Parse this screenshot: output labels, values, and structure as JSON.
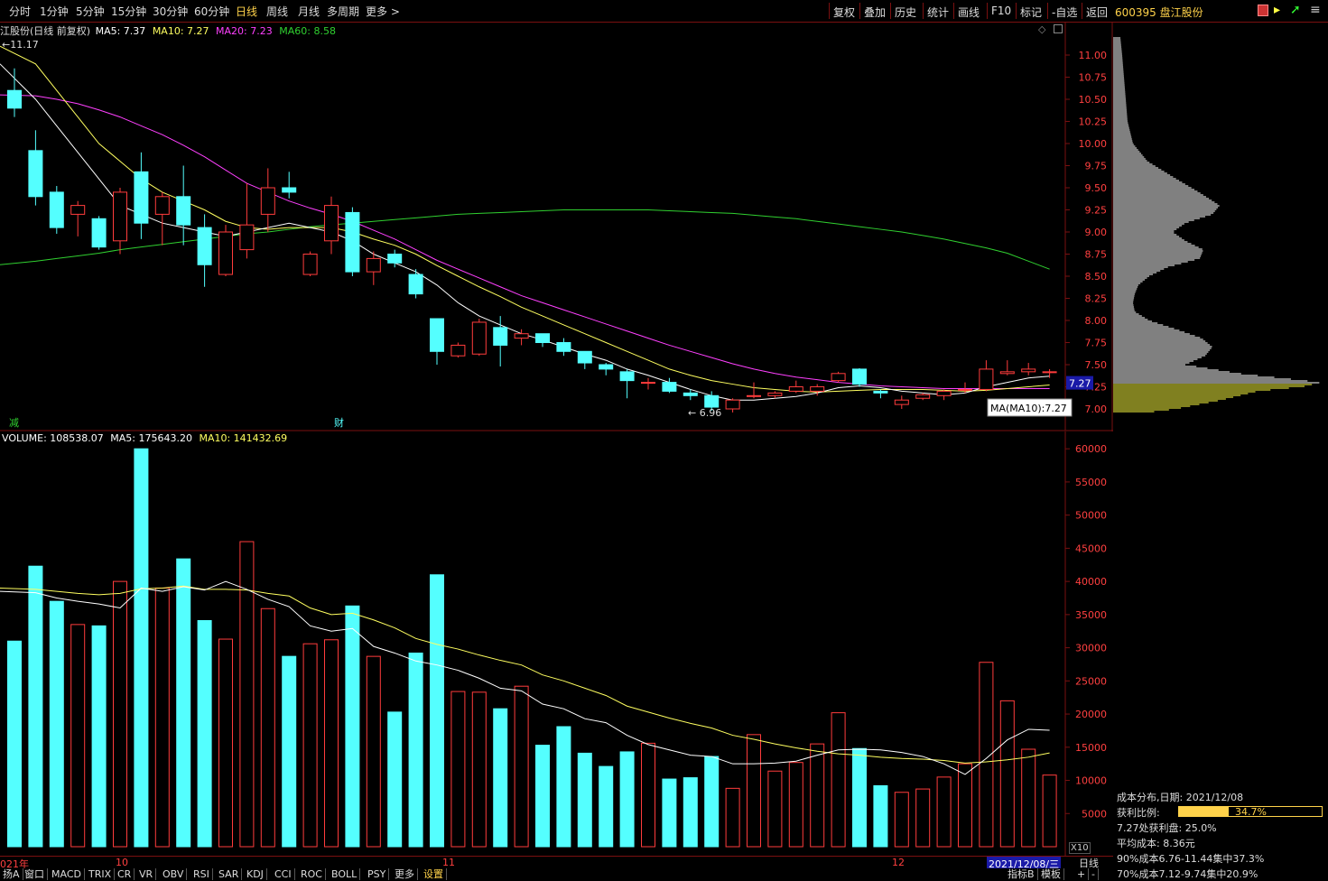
{
  "topbar": {
    "tabs": [
      "分时",
      "1分钟",
      "5分钟",
      "15分钟",
      "30分钟",
      "60分钟",
      "日线",
      "周线",
      "月线",
      "多周期",
      "更多 >"
    ],
    "active_tab": "日线",
    "right_buttons": [
      "复权",
      "叠加",
      "历史",
      "统计",
      "画线",
      "F10",
      "标记",
      "-自选",
      "返回"
    ]
  },
  "stock": {
    "code_name": "600395 盘江股份"
  },
  "price_header": {
    "name": "江股份(日线 前复权)",
    "ma5": "MA5: 7.37",
    "ma10": "MA10: 7.27",
    "ma20": "MA20: 7.23",
    "ma60": "MA60: 8.58"
  },
  "price_chart": {
    "high_label": "11.17",
    "low_label": "6.96",
    "current_price_tag": "7.27",
    "ma_tooltip": "MA(MA10):7.27",
    "y_ticks": [
      "11.00",
      "10.75",
      "10.50",
      "10.25",
      "10.00",
      "9.75",
      "9.50",
      "9.25",
      "9.00",
      "8.75",
      "8.50",
      "8.25",
      "8.00",
      "7.75",
      "7.50",
      "7.25",
      "7.00"
    ],
    "markers": [
      "减",
      "财"
    ]
  },
  "volume_header": {
    "volume": "VOLUME: 108538.07",
    "ma5": "MA5: 175643.20",
    "ma10": "MA10: 141432.69"
  },
  "volume_chart": {
    "y_ticks": [
      "60000",
      "55000",
      "50000",
      "45000",
      "40000",
      "35000",
      "30000",
      "25000",
      "20000",
      "15000",
      "10000",
      "5000"
    ],
    "unit": "X10"
  },
  "x_axis": {
    "labels": [
      "021年",
      "10",
      "11",
      "12"
    ],
    "date_box": "2021/12/08/三",
    "period": "日线"
  },
  "bottom_tabs": [
    "扬A",
    "窗口",
    "MACD",
    "TRIX",
    "CR",
    "VR",
    "OBV",
    "RSI",
    "SAR",
    "KDJ",
    "CCI",
    "ROC",
    "BOLL",
    "PSY",
    "更多",
    "设置"
  ],
  "bottom_right": [
    "+",
    "-",
    "指标B",
    "模板"
  ],
  "cost_panel": {
    "title": "成本分布,日期: 2021/12/08",
    "profit_ratio_label": "获利比例:",
    "profit_ratio_value": "34.7%",
    "profit_ratio": 0.347,
    "line3": "7.27处获利盘: 25.0%",
    "line4": "平均成本: 8.36元",
    "line5": "90%成本6.76-11.44集中37.3%",
    "line6": "70%成本7.12-9.74集中20.9%"
  },
  "colors": {
    "up": "#ff3c3c",
    "down": "#54ffff",
    "ma5": "#ffffff",
    "ma10": "#ffff60",
    "ma20": "#ff40ff",
    "ma60": "#30d030",
    "grid": "#7a1010",
    "accent_yellow": "#ffd24a"
  },
  "chart_data": {
    "type": "candlestick",
    "candles": [
      {
        "o": 10.6,
        "h": 10.85,
        "l": 10.3,
        "c": 10.4
      },
      {
        "o": 9.92,
        "h": 10.15,
        "l": 9.3,
        "c": 9.4
      },
      {
        "o": 9.45,
        "h": 9.52,
        "l": 8.98,
        "c": 9.05
      },
      {
        "o": 9.2,
        "h": 9.35,
        "l": 8.95,
        "c": 9.3
      },
      {
        "o": 9.15,
        "h": 9.18,
        "l": 8.8,
        "c": 8.83
      },
      {
        "o": 8.9,
        "h": 9.5,
        "l": 8.75,
        "c": 9.45
      },
      {
        "o": 9.68,
        "h": 9.9,
        "l": 8.92,
        "c": 9.1
      },
      {
        "o": 9.2,
        "h": 9.45,
        "l": 8.85,
        "c": 9.4
      },
      {
        "o": 9.4,
        "h": 9.75,
        "l": 8.85,
        "c": 9.08
      },
      {
        "o": 9.05,
        "h": 9.2,
        "l": 8.38,
        "c": 8.63
      },
      {
        "o": 8.52,
        "h": 9.08,
        "l": 8.5,
        "c": 9.0
      },
      {
        "o": 8.8,
        "h": 9.55,
        "l": 8.7,
        "c": 9.08
      },
      {
        "o": 9.2,
        "h": 9.72,
        "l": 9.0,
        "c": 9.5
      },
      {
        "o": 9.5,
        "h": 9.68,
        "l": 9.38,
        "c": 9.45
      },
      {
        "o": 8.52,
        "h": 8.78,
        "l": 8.5,
        "c": 8.75
      },
      {
        "o": 8.9,
        "h": 9.4,
        "l": 8.75,
        "c": 9.3
      },
      {
        "o": 9.22,
        "h": 9.28,
        "l": 8.5,
        "c": 8.55
      },
      {
        "o": 8.55,
        "h": 8.78,
        "l": 8.4,
        "c": 8.7
      },
      {
        "o": 8.75,
        "h": 8.8,
        "l": 8.6,
        "c": 8.65
      },
      {
        "o": 8.52,
        "h": 8.58,
        "l": 8.25,
        "c": 8.3
      },
      {
        "o": 8.02,
        "h": 8.02,
        "l": 7.5,
        "c": 7.65
      },
      {
        "o": 7.6,
        "h": 7.75,
        "l": 7.58,
        "c": 7.72
      },
      {
        "o": 7.62,
        "h": 8.02,
        "l": 7.6,
        "c": 7.98
      },
      {
        "o": 7.92,
        "h": 8.05,
        "l": 7.48,
        "c": 7.72
      },
      {
        "o": 7.8,
        "h": 7.9,
        "l": 7.72,
        "c": 7.85
      },
      {
        "o": 7.85,
        "h": 7.85,
        "l": 7.7,
        "c": 7.75
      },
      {
        "o": 7.75,
        "h": 7.8,
        "l": 7.6,
        "c": 7.65
      },
      {
        "o": 7.65,
        "h": 7.65,
        "l": 7.45,
        "c": 7.52
      },
      {
        "o": 7.5,
        "h": 7.52,
        "l": 7.38,
        "c": 7.45
      },
      {
        "o": 7.42,
        "h": 7.45,
        "l": 7.12,
        "c": 7.32
      },
      {
        "o": 7.3,
        "h": 7.35,
        "l": 7.22,
        "c": 7.3
      },
      {
        "o": 7.3,
        "h": 7.35,
        "l": 7.18,
        "c": 7.2
      },
      {
        "o": 7.18,
        "h": 7.22,
        "l": 7.1,
        "c": 7.15
      },
      {
        "o": 7.15,
        "h": 7.2,
        "l": 6.98,
        "c": 7.02
      },
      {
        "o": 7.0,
        "h": 7.12,
        "l": 6.96,
        "c": 7.1
      },
      {
        "o": 7.15,
        "h": 7.3,
        "l": 7.12,
        "c": 7.15
      },
      {
        "o": 7.15,
        "h": 7.2,
        "l": 7.12,
        "c": 7.18
      },
      {
        "o": 7.2,
        "h": 7.32,
        "l": 7.18,
        "c": 7.25
      },
      {
        "o": 7.2,
        "h": 7.28,
        "l": 7.15,
        "c": 7.25
      },
      {
        "o": 7.32,
        "h": 7.42,
        "l": 7.3,
        "c": 7.4
      },
      {
        "o": 7.45,
        "h": 7.46,
        "l": 7.25,
        "c": 7.28
      },
      {
        "o": 7.2,
        "h": 7.22,
        "l": 7.12,
        "c": 7.18
      },
      {
        "o": 7.05,
        "h": 7.15,
        "l": 7.0,
        "c": 7.1
      },
      {
        "o": 7.12,
        "h": 7.18,
        "l": 7.1,
        "c": 7.16
      },
      {
        "o": 7.15,
        "h": 7.22,
        "l": 7.1,
        "c": 7.2
      },
      {
        "o": 7.22,
        "h": 7.3,
        "l": 7.18,
        "c": 7.22
      },
      {
        "o": 7.22,
        "h": 7.55,
        "l": 7.2,
        "c": 7.45
      },
      {
        "o": 7.4,
        "h": 7.55,
        "l": 7.38,
        "c": 7.42
      },
      {
        "o": 7.42,
        "h": 7.52,
        "l": 7.38,
        "c": 7.45
      },
      {
        "o": 7.42,
        "h": 7.45,
        "l": 7.35,
        "c": 7.42
      }
    ],
    "volume": [
      31000,
      42300,
      37000,
      33500,
      33300,
      40000,
      60000,
      39000,
      43400,
      34100,
      31300,
      46000,
      35900,
      28700,
      30600,
      31200,
      36300,
      28700,
      20300,
      29200,
      41000,
      23400,
      23300,
      20800,
      24200,
      15300,
      18100,
      14100,
      12100,
      14300,
      15600,
      10200,
      10400,
      13600,
      8800,
      16900,
      11400,
      12700,
      15500,
      20200,
      14800,
      9200,
      8200,
      8700,
      10500,
      12500,
      27800,
      22000,
      14700,
      10800
    ],
    "ma5": [
      10.9,
      10.5,
      10.2,
      9.9,
      9.6,
      9.3,
      9.2,
      9.1,
      9.05,
      9.0,
      8.95,
      9.0,
      9.05,
      9.1,
      9.05,
      9.0,
      8.9,
      8.75,
      8.65,
      8.55,
      8.4,
      8.2,
      8.05,
      7.95,
      7.85,
      7.78,
      7.7,
      7.62,
      7.55,
      7.45,
      7.38,
      7.3,
      7.22,
      7.15,
      7.1,
      7.1,
      7.12,
      7.14,
      7.18,
      7.24,
      7.26,
      7.24,
      7.2,
      7.18,
      7.16,
      7.18,
      7.25,
      7.3,
      7.35,
      7.37
    ],
    "ma10": [
      11.1,
      10.9,
      10.6,
      10.3,
      10.0,
      9.8,
      9.6,
      9.45,
      9.35,
      9.25,
      9.12,
      9.05,
      9.03,
      9.05,
      9.05,
      9.05,
      9.0,
      8.92,
      8.85,
      8.75,
      8.62,
      8.5,
      8.38,
      8.27,
      8.15,
      8.05,
      7.95,
      7.85,
      7.75,
      7.65,
      7.55,
      7.45,
      7.38,
      7.32,
      7.28,
      7.24,
      7.22,
      7.2,
      7.19,
      7.2,
      7.21,
      7.22,
      7.22,
      7.22,
      7.21,
      7.2,
      7.21,
      7.23,
      7.25,
      7.27
    ],
    "ma20": [
      10.55,
      10.54,
      10.5,
      10.45,
      10.38,
      10.3,
      10.2,
      10.1,
      9.98,
      9.85,
      9.7,
      9.55,
      9.45,
      9.35,
      9.27,
      9.2,
      9.12,
      9.02,
      8.92,
      8.8,
      8.68,
      8.58,
      8.48,
      8.38,
      8.28,
      8.2,
      8.12,
      8.04,
      7.96,
      7.88,
      7.8,
      7.72,
      7.65,
      7.58,
      7.51,
      7.45,
      7.4,
      7.36,
      7.33,
      7.3,
      7.28,
      7.26,
      7.25,
      7.24,
      7.23,
      7.23,
      7.23,
      7.23,
      7.23,
      7.23
    ],
    "ma60": [
      8.63,
      8.67,
      8.7,
      8.73,
      8.76,
      8.8,
      8.83,
      8.86,
      8.89,
      8.92,
      8.95,
      8.98,
      9.0,
      9.03,
      9.06,
      9.08,
      9.1,
      9.12,
      9.14,
      9.16,
      9.18,
      9.2,
      9.21,
      9.22,
      9.23,
      9.24,
      9.25,
      9.25,
      9.25,
      9.25,
      9.25,
      9.24,
      9.23,
      9.22,
      9.21,
      9.19,
      9.17,
      9.15,
      9.12,
      9.09,
      9.06,
      9.03,
      9.0,
      8.96,
      8.92,
      8.87,
      8.82,
      8.76,
      8.67,
      8.58
    ],
    "vol_ma5": [
      38500,
      38300,
      37500,
      37000,
      36600,
      36000,
      39000,
      38500,
      39200,
      38700,
      40000,
      38800,
      37300,
      36200,
      33300,
      32500,
      32900,
      30200,
      29200,
      28000,
      27400,
      26600,
      25400,
      23900,
      23500,
      21500,
      20800,
      19300,
      18700,
      16800,
      15400,
      14600,
      13800,
      13600,
      12500,
      12500,
      12600,
      12900,
      13800,
      14600,
      14700,
      14600,
      14200,
      13600,
      12500,
      10900,
      13300,
      16100,
      17700,
      17560
    ],
    "vol_ma10": [
      39000,
      38800,
      38500,
      38200,
      38000,
      38200,
      38900,
      39000,
      39300,
      38800,
      38800,
      38700,
      38200,
      37800,
      36000,
      35000,
      35200,
      34200,
      33000,
      31400,
      30500,
      29800,
      28900,
      28100,
      27400,
      25900,
      25000,
      23900,
      22800,
      21200,
      20300,
      19400,
      18600,
      17900,
      16800,
      16200,
      15500,
      14900,
      14400,
      14000,
      13800,
      13500,
      13300,
      13200,
      13000,
      12600,
      12800,
      13100,
      13500,
      14140
    ]
  }
}
